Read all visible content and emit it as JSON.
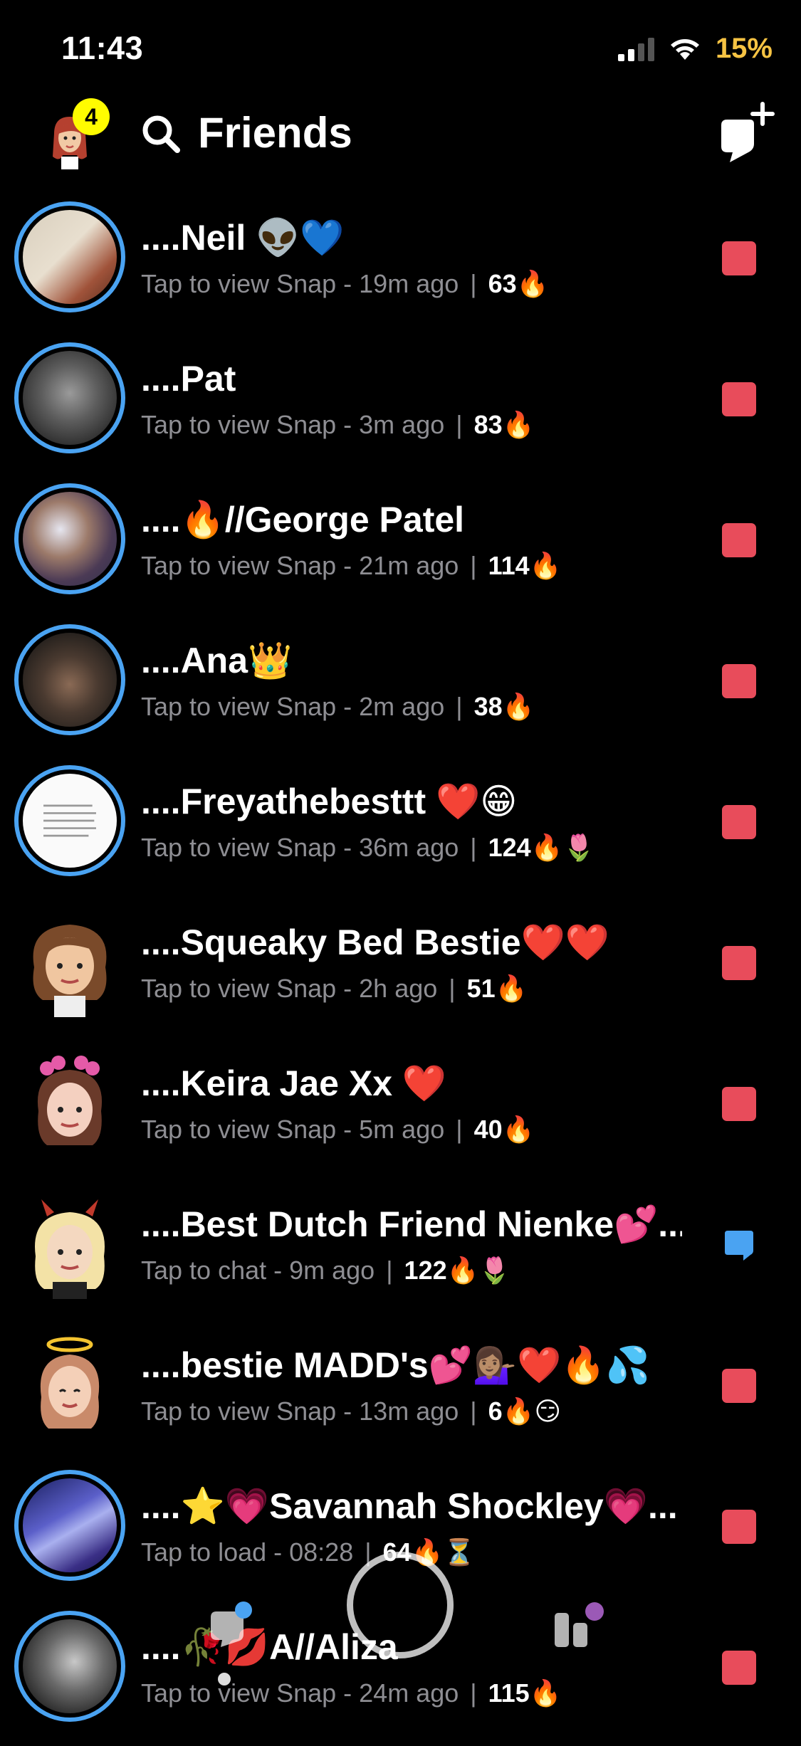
{
  "status_bar": {
    "time": "11:43",
    "battery": "15%",
    "battery_color": "#f6c343"
  },
  "header": {
    "title": "Friends",
    "badge_count": "4",
    "search_icon": "search-icon",
    "new_chat_icon": "new-chat-icon"
  },
  "colors": {
    "ring_blue": "#4aa3f2",
    "new_snap_red": "#e84c5b",
    "chat_blue": "#4aa3f2",
    "subtext_gray": "#8e8e93"
  },
  "friends": [
    {
      "name": "....Neil 👽💙",
      "status": "Tap to view Snap - 19m ago",
      "streak": "63🔥",
      "type": "snap"
    },
    {
      "name": "....Pat",
      "status": "Tap to view Snap - 3m ago",
      "streak": "83🔥",
      "type": "snap"
    },
    {
      "name": "....🔥//George Patel",
      "status": "Tap to view Snap - 21m ago",
      "streak": "114🔥",
      "type": "snap"
    },
    {
      "name": "....Ana👑",
      "status": "Tap to view Snap - 2m ago",
      "streak": "38🔥",
      "type": "snap"
    },
    {
      "name": "....Freyathebesttt ❤️😁",
      "status": "Tap to view Snap - 36m ago",
      "streak": "124🔥🌷",
      "type": "snap"
    },
    {
      "name": "....Squeaky Bed Bestie❤️❤️",
      "status": "Tap to view Snap - 2h ago",
      "streak": "51🔥",
      "type": "snap"
    },
    {
      "name": "....Keira Jae Xx ❤️",
      "status": "Tap to view Snap - 5m ago",
      "streak": "40🔥",
      "type": "snap"
    },
    {
      "name": "....Best Dutch Friend Nienke💕...",
      "status": "Tap to chat - 9m ago",
      "streak": "122🔥🌷",
      "type": "chat"
    },
    {
      "name": "....bestie MADD's💕💁🏽‍♀️❤️🔥💦",
      "status": "Tap to view Snap - 13m ago",
      "streak": "6🔥😏",
      "type": "snap"
    },
    {
      "name": "....⭐💗Savannah Shockley💗...",
      "status": "Tap to load - 08:28",
      "streak": "64🔥⏳",
      "type": "snap"
    },
    {
      "name": "....🥀💋A//Aliza",
      "status": "Tap to view Snap - 24m ago",
      "streak": "115🔥",
      "type": "snap"
    }
  ],
  "bottom_nav": {
    "chat_icon": "chat-nav-icon",
    "capture_icon": "capture-button",
    "discover_icon": "discover-nav-icon"
  }
}
